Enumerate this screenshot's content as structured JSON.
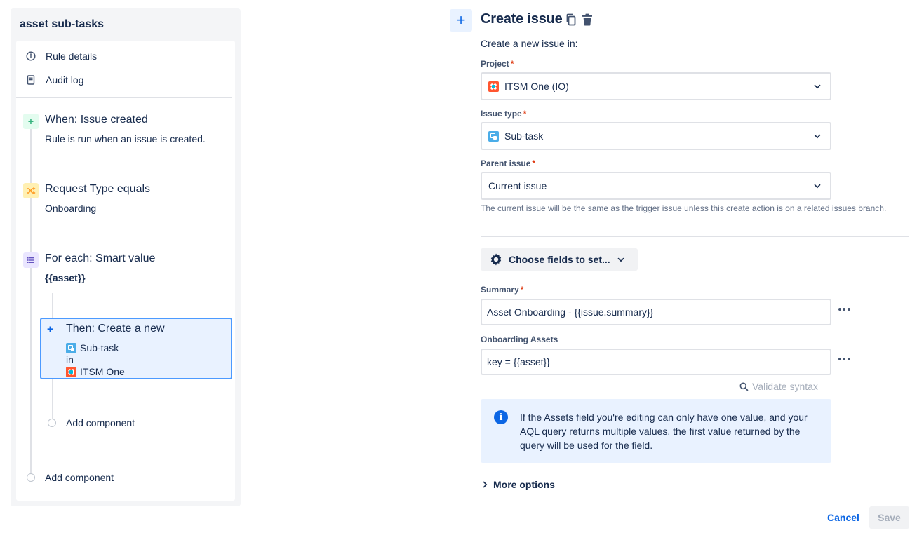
{
  "sidebar": {
    "rule_title": "asset sub-tasks",
    "nav": [
      {
        "label": "Rule details",
        "icon": "info-icon"
      },
      {
        "label": "Audit log",
        "icon": "document-icon"
      }
    ],
    "trigger": {
      "title": "When: Issue created",
      "subtitle": "Rule is run when an issue is created.",
      "icon": "plus-icon",
      "color": "#36b37e"
    },
    "condition": {
      "title": "Request Type equals",
      "subtitle": "Onboarding",
      "icon": "shuffle-icon",
      "color": "#ffab00"
    },
    "branch": {
      "title": "For each: Smart value",
      "subtitle": "{{asset}}",
      "icon": "list-icon",
      "color": "#6554c0"
    },
    "action": {
      "title": "Then: Create a new",
      "issue_type": "Sub-task",
      "connector": "in",
      "project": "ITSM One"
    },
    "add_component_inner": "Add component",
    "add_component_outer": "Add component"
  },
  "editor": {
    "title": "Create issue",
    "intro": "Create a new issue in:",
    "project": {
      "label": "Project",
      "value": "ITSM One (IO)"
    },
    "issue_type": {
      "label": "Issue type",
      "value": "Sub-task"
    },
    "parent_issue": {
      "label": "Parent issue",
      "value": "Current issue",
      "help": "The current issue will be the same as the trigger issue unless this create action is on a related issues branch."
    },
    "choose_fields": "Choose fields to set...",
    "summary": {
      "label": "Summary",
      "value": "Asset Onboarding - {{issue.summary}}"
    },
    "onboarding_assets": {
      "label": "Onboarding Assets",
      "value": "key = {{asset}}"
    },
    "validate": "Validate syntax",
    "info": "If the Assets field you're editing can only have one value, and your AQL query returns multiple values, the first value returned by the query will be used for the field.",
    "more_options": "More options",
    "cancel": "Cancel",
    "save": "Save"
  },
  "colors": {
    "accent": "#0c66e4",
    "selected_bg": "#e9f2ff",
    "selected_border": "#4c9aff",
    "required": "#de350b"
  }
}
